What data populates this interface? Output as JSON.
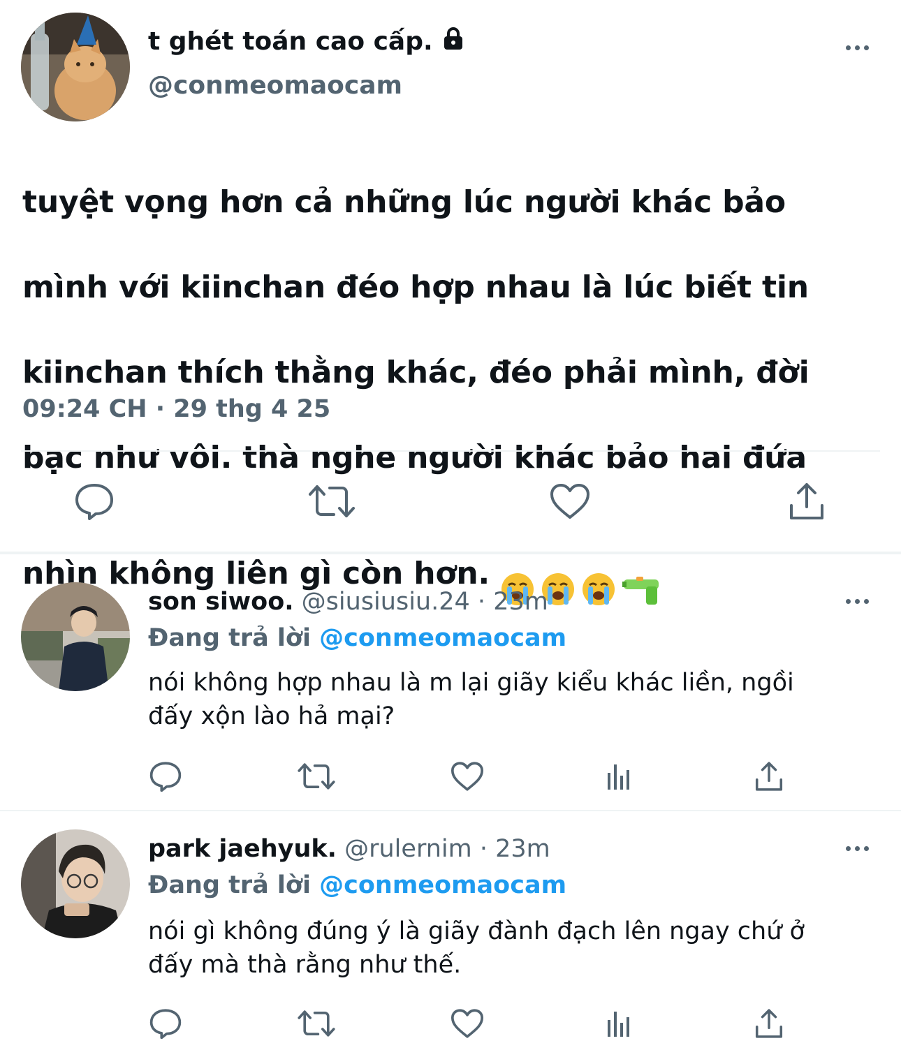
{
  "main_tweet": {
    "display_name": "t ghét toán cao cấp.",
    "handle": "@conmeomaocam",
    "lines": [
      "tuyệt vọng hơn cả những lúc người khác bảo",
      "mình với kiinchan đéo hợp nhau là lúc biết tin",
      "kiinchan thích thằng khác, đéo phải mình, đời",
      "bạc như vôi. thà nghe người khác bảo hai đứa",
      "nhìn không liên gì còn hơn."
    ],
    "emojis": [
      "loudly-crying-face",
      "loudly-crying-face",
      "loudly-crying-face",
      "water-pistol"
    ],
    "timestamp": "09:24 CH · 29 thg 4 25",
    "icons": [
      "reply-icon",
      "retweet-icon",
      "like-icon",
      "share-icon",
      "lock-icon",
      "more-icon"
    ]
  },
  "replies": [
    {
      "display_name": "son siwoo.",
      "handle": "@siusiusiu.24",
      "separator": "·",
      "time": "23m",
      "replying_prefix": "Đang trả lời",
      "replying_to": "@conmeomaocam",
      "lines": [
        "nói không hợp nhau là m lại giãy kiểu khác liền, ngồi",
        "đấy xộn lào hả mại?"
      ]
    },
    {
      "display_name": "park jaehyuk.",
      "handle": "@rulernim",
      "separator": "·",
      "time": "23m",
      "replying_prefix": "Đang trả lời",
      "replying_to": "@conmeomaocam",
      "lines": [
        "nói gì không đúng ý là giãy đành đạch lên ngay chứ ở",
        "đấy mà thà rằng như thế."
      ]
    }
  ],
  "colors": {
    "text": "#0f1419",
    "secondary": "#536471",
    "accent": "#1d9bf0",
    "divider": "#eff3f4"
  }
}
